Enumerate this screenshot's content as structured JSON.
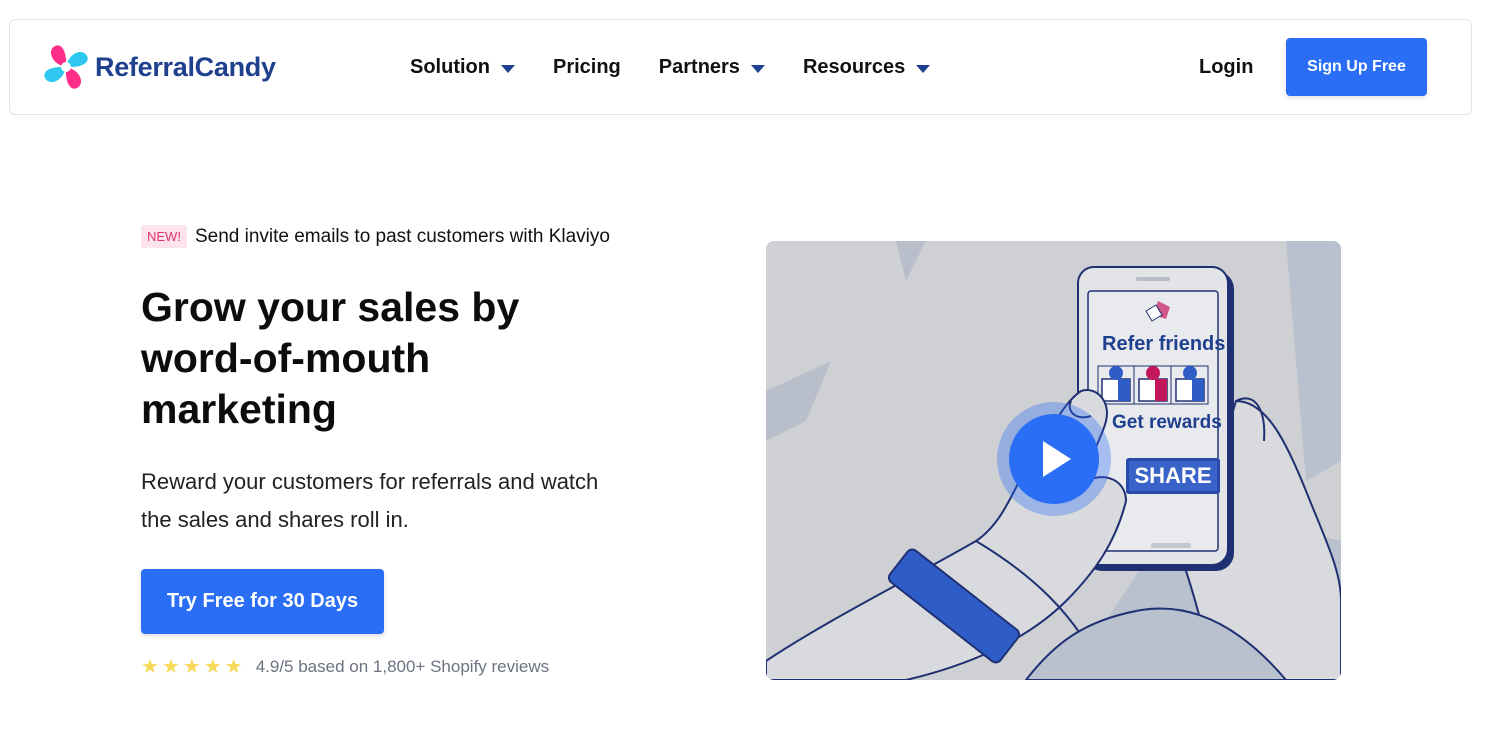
{
  "brand": {
    "name": "ReferralCandy"
  },
  "nav": {
    "items": [
      {
        "label": "Solution",
        "dropdown": true
      },
      {
        "label": "Pricing",
        "dropdown": false
      },
      {
        "label": "Partners",
        "dropdown": true
      },
      {
        "label": "Resources",
        "dropdown": true
      }
    ],
    "login_label": "Login",
    "signup_label": "Sign Up Free"
  },
  "hero": {
    "badge": "NEW!",
    "announcement": "Send invite emails to past customers with Klaviyo",
    "headline": "Grow your sales by word-of-mouth marketing",
    "subtext": "Reward your customers for referrals and watch the sales and shares roll in.",
    "cta_label": "Try Free for 30 Days",
    "rating": {
      "stars": 5,
      "text": "4.9/5 based on 1,800+ Shopify reviews"
    }
  },
  "video": {
    "refer_text": "Refer friends",
    "rewards_text": "Get rewards",
    "share_text": "SHARE"
  },
  "colors": {
    "accent": "#2a6ef5",
    "brand_navy": "#1f3f8f",
    "badge_bg": "#fde3ec",
    "badge_text": "#e0356f",
    "star": "#f7d95a"
  },
  "icons": [
    "referralcandy-logo-icon",
    "chevron-down-icon",
    "star-icon",
    "play-icon"
  ]
}
